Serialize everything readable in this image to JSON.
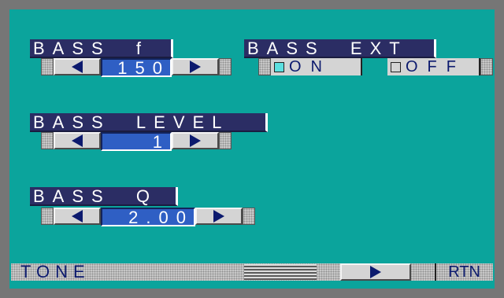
{
  "bass_f": {
    "label": "BASS  f",
    "value": "150"
  },
  "bass_ext": {
    "label": "BASS  EXT",
    "on_label": "ON",
    "off_label": "OFF",
    "on_color": "#5ce0e0",
    "off_color": "#d4d4d4",
    "selected": "ON"
  },
  "bass_level": {
    "label": "BASS  LEVEL",
    "value": "1"
  },
  "bass_q": {
    "label": "BASS  Q",
    "value": "2.00"
  },
  "bottom_bar": {
    "tone_label": "TONE",
    "rtn_label": "RTN"
  },
  "icons": {
    "left": "left-arrow-icon",
    "right": "right-arrow-icon",
    "lines": "menu-lines-icon"
  },
  "colors": {
    "background": "#0ba49c",
    "label_bg": "#2b2d64",
    "value_bg": "#2f5fc4"
  }
}
